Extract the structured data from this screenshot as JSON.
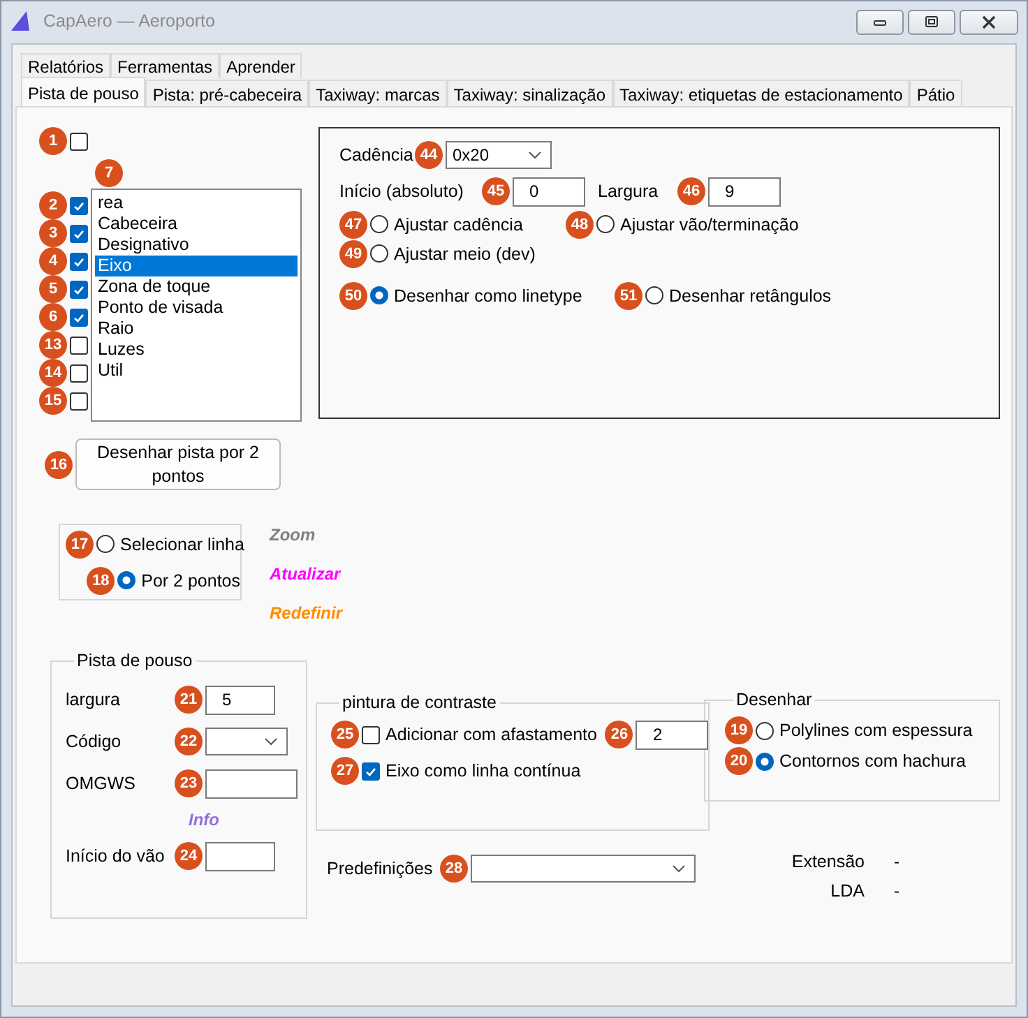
{
  "window": {
    "title": "CapAero — Aeroporto"
  },
  "tabs_top": [
    {
      "label": "Relatórios",
      "selected": false
    },
    {
      "label": "Ferramentas",
      "selected": false
    },
    {
      "label": "Aprender",
      "selected": false
    }
  ],
  "tabs": [
    {
      "label": "Pista de pouso",
      "selected": true
    },
    {
      "label": "Pista: pré-cabeceira",
      "selected": false
    },
    {
      "label": "Taxiway: marcas",
      "selected": false
    },
    {
      "label": "Taxiway: sinalização",
      "selected": false
    },
    {
      "label": "Taxiway: etiquetas de estacionamento",
      "selected": false
    },
    {
      "label": "Pátio",
      "selected": false
    }
  ],
  "enable_checkbox": {
    "badge": "1",
    "checked": false
  },
  "layer_checkboxes": [
    {
      "badge": "2",
      "checked": true
    },
    {
      "badge": "3",
      "checked": true
    },
    {
      "badge": "4",
      "checked": true
    },
    {
      "badge": "5",
      "checked": true
    },
    {
      "badge": "6",
      "checked": true
    },
    {
      "badge": "13",
      "checked": false
    },
    {
      "badge": "14",
      "checked": false
    },
    {
      "badge": "15",
      "checked": false
    }
  ],
  "layer_list": {
    "badge": "7",
    "items": [
      {
        "label": "rea",
        "selected": false
      },
      {
        "label": "Cabeceira",
        "selected": false
      },
      {
        "label": "Designativo",
        "selected": false
      },
      {
        "label": "Eixo",
        "selected": true
      },
      {
        "label": "Zona de toque",
        "selected": false
      },
      {
        "label": "Ponto de visada",
        "selected": false
      },
      {
        "label": "Raio",
        "selected": false
      },
      {
        "label": "Luzes",
        "selected": false
      },
      {
        "label": "Util",
        "selected": false
      }
    ]
  },
  "pattern": {
    "cadence": {
      "label": "Cadência",
      "badge": "44",
      "value": "0x20"
    },
    "start": {
      "label": "Início (absoluto)",
      "badge": "45",
      "value": "0"
    },
    "width": {
      "label": "Largura",
      "badge": "46",
      "value": "9"
    },
    "option_rows": [
      [
        {
          "badge": "47",
          "label": "Ajustar cadência",
          "selected": false
        },
        {
          "badge": "48",
          "label": "Ajustar vão/terminação",
          "selected": false
        }
      ],
      [
        {
          "badge": "49",
          "label": "Ajustar meio (dev)",
          "selected": false
        }
      ],
      [
        {
          "badge": "50",
          "label": "Desenhar como linetype",
          "selected": true
        },
        {
          "badge": "51",
          "label": "Desenhar retângulos",
          "selected": false
        }
      ]
    ]
  },
  "draw_button": {
    "badge": "16",
    "label": "Desenhar pista por 2 pontos"
  },
  "selection_modes": [
    {
      "badge": "17",
      "label": "Selecionar linha",
      "selected": false
    },
    {
      "badge": "18",
      "label": "Por 2 pontos",
      "selected": true
    }
  ],
  "actions": [
    {
      "label": "Zoom",
      "color": "#808080"
    },
    {
      "label": "Atualizar",
      "color": "#ff00ff"
    },
    {
      "label": "Redefinir",
      "color": "#ff8c00"
    }
  ],
  "runway_group": {
    "title": "Pista de pouso",
    "rows": [
      {
        "kind": "text",
        "label": "largura",
        "badge": "21",
        "value": "5"
      },
      {
        "kind": "select",
        "label": "Código",
        "badge": "22",
        "value": ""
      },
      {
        "kind": "text",
        "label": "OMGWS",
        "badge": "23",
        "value": ""
      },
      {
        "kind": "link",
        "label": "Info"
      },
      {
        "kind": "text",
        "label": "Início do vão",
        "badge": "24",
        "value": ""
      }
    ]
  },
  "contrast_group": {
    "title": "pintura de contraste",
    "offset": {
      "badge": "25",
      "label": "Adicionar com afastamento",
      "checked": false
    },
    "offset_value": {
      "badge": "26",
      "value": "2"
    },
    "continuous": {
      "badge": "27",
      "label": "Eixo como linha contínua",
      "checked": true
    }
  },
  "presets": {
    "label": "Predefinições",
    "badge": "28"
  },
  "draw_group": {
    "title": "Desenhar",
    "options": [
      {
        "badge": "19",
        "label": "Polylines com espessura",
        "selected": false
      },
      {
        "badge": "20",
        "label": "Contornos com hachura",
        "selected": true
      }
    ]
  },
  "stats": [
    {
      "label": "Extensão",
      "value": "-"
    },
    {
      "label": "LDA",
      "value": "-"
    }
  ]
}
